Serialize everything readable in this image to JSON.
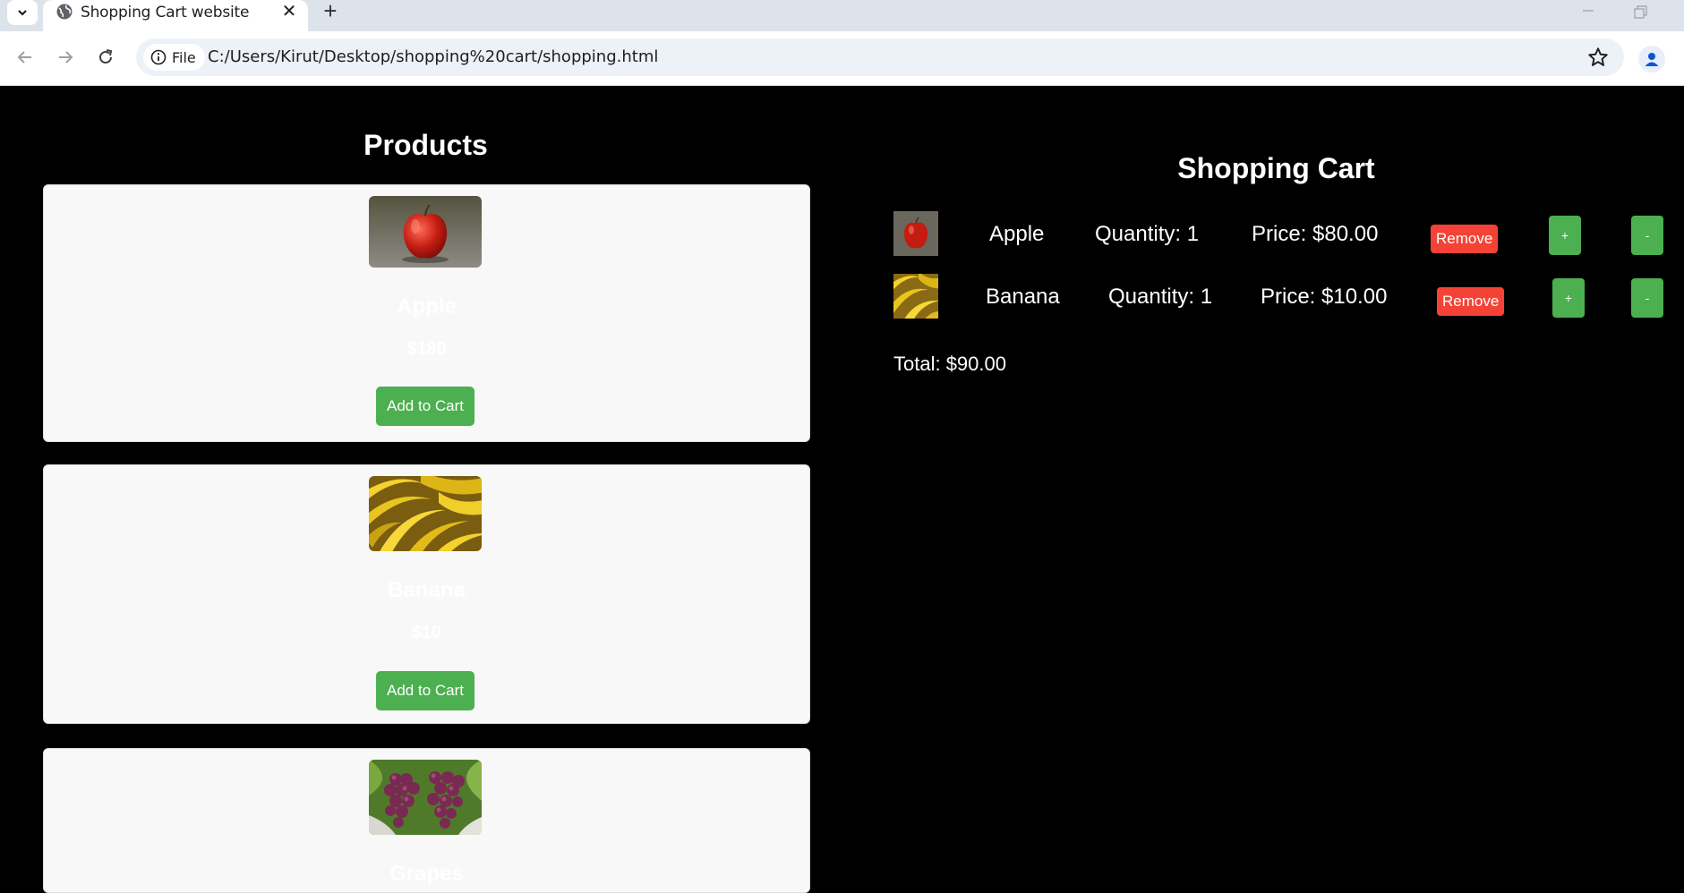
{
  "browser": {
    "tab_title": "Shopping Cart website",
    "address_chip": "File",
    "url": "C:/Users/Kirut/Desktop/shopping%20cart/shopping.html"
  },
  "products": {
    "heading": "Products",
    "add_label": "Add to Cart",
    "items": [
      {
        "name": "Apple",
        "price": "$180",
        "image": "apple"
      },
      {
        "name": "Banana",
        "price": "$10",
        "image": "banana"
      },
      {
        "name": "Grapes",
        "image": "grapes"
      }
    ]
  },
  "cart": {
    "heading": "Shopping Cart",
    "remove_label": "Remove",
    "plus_label": "+",
    "minus_label": "-",
    "items": [
      {
        "name": "Apple",
        "quantity": "Quantity: 1",
        "price": "Price: $80.00"
      },
      {
        "name": "Banana",
        "quantity": "Quantity: 1",
        "price": "Price: $10.00"
      }
    ],
    "total": "Total: $90.00"
  },
  "colors": {
    "page_background": "#000000",
    "card_background": "#f8f8f8",
    "add_button": "#4caf50",
    "remove_button": "#f44336",
    "step_button": "#4caf50"
  }
}
